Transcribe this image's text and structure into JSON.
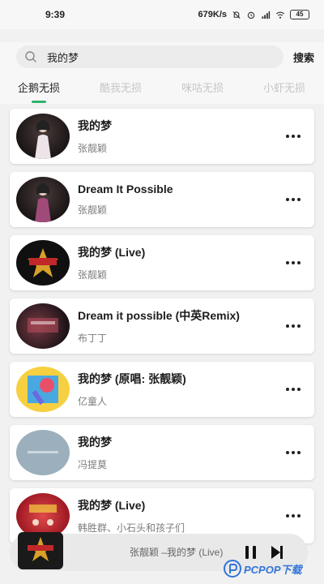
{
  "status_bar": {
    "time": "9:39",
    "speed": "679K/s",
    "battery": "45",
    "icons": [
      "mute-icon",
      "alarm-icon",
      "signal-icon",
      "wifi-icon",
      "battery-icon"
    ]
  },
  "search": {
    "value": "我的梦",
    "placeholder": "",
    "button_label": "搜索"
  },
  "tabs": [
    {
      "label": "企鹅无损",
      "active": true
    },
    {
      "label": "酷我无损",
      "active": false
    },
    {
      "label": "咪咕无损",
      "active": false
    },
    {
      "label": "小虾无损",
      "active": false
    }
  ],
  "songs": [
    {
      "title": "我的梦",
      "artist": "张靓颖"
    },
    {
      "title": "Dream It Possible",
      "artist": "张靓颖"
    },
    {
      "title": "我的梦 (Live)",
      "artist": "张靓颖"
    },
    {
      "title": "Dream it possible (中英Remix)",
      "artist": "布丁丁"
    },
    {
      "title": "我的梦 (原唱: 张靓颖)",
      "artist": "亿童人"
    },
    {
      "title": "我的梦",
      "artist": "冯提莫"
    },
    {
      "title": "我的梦 (Live)",
      "artist": "韩胜群、小石头和孩子们"
    }
  ],
  "player": {
    "now_playing": "张靓颖  –我的梦 (Live)"
  },
  "watermark": {
    "text": "PCPOP下载"
  },
  "colors": {
    "accent": "#2fb36b",
    "background": "#f1f1f1",
    "card": "#ffffff",
    "watermark": "#3374d8"
  }
}
